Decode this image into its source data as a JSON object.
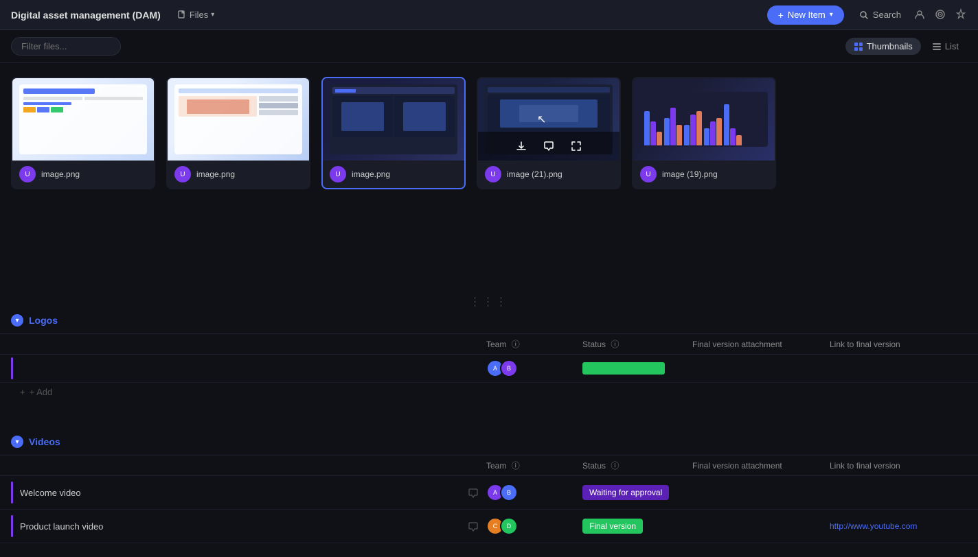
{
  "header": {
    "title": "Digital asset management (DAM)",
    "files_label": "Files",
    "new_item_label": "New Item",
    "search_label": "Search"
  },
  "toolbar": {
    "filter_placeholder": "Filter files...",
    "thumbnails_label": "Thumbnails",
    "list_label": "List"
  },
  "files": [
    {
      "id": 1,
      "name": "image.png",
      "thumb_class": "t1"
    },
    {
      "id": 2,
      "name": "image.png",
      "thumb_class": "t2"
    },
    {
      "id": 3,
      "name": "image.png",
      "thumb_class": "t3",
      "selected": true
    },
    {
      "id": 4,
      "name": "image (21).png",
      "thumb_class": "t4",
      "hovered": true
    },
    {
      "id": 5,
      "name": "image (19).png",
      "thumb_class": "t5"
    }
  ],
  "logos_section": {
    "title": "Logos",
    "columns": {
      "team": "Team",
      "status": "Status",
      "attachment": "Final version attachment",
      "link": "Link to final version"
    },
    "add_label": "+ Add",
    "status_bar": ""
  },
  "videos_section": {
    "title": "Videos",
    "columns": {
      "team": "Team",
      "status": "Status",
      "attachment": "Final version attachment",
      "link": "Link to final version"
    },
    "rows": [
      {
        "name": "Welcome video",
        "status": "Waiting for approval",
        "status_class": "waiting",
        "link": "",
        "link_label": ""
      },
      {
        "name": "Product launch video",
        "status": "Final version",
        "status_class": "final",
        "link": "http://www.youtube.com",
        "link_label": "http://www.youtube.com"
      }
    ]
  }
}
